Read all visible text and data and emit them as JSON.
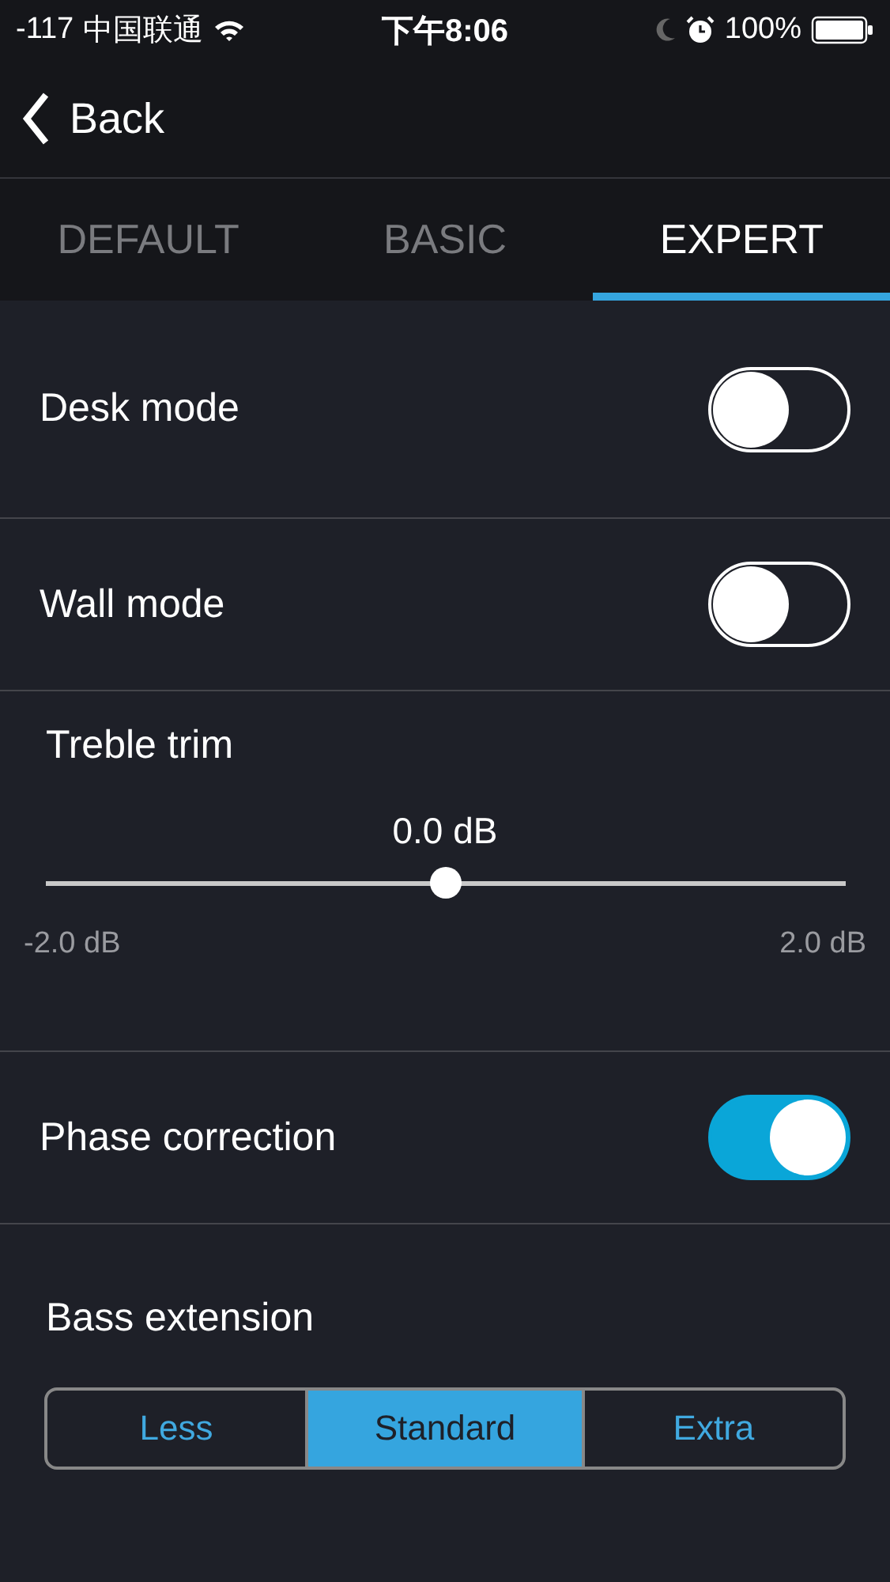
{
  "status_bar": {
    "signal": "-117",
    "carrier": "中国联通",
    "time": "下午8:06",
    "battery": "100%"
  },
  "nav": {
    "back": "Back"
  },
  "tabs": [
    {
      "label": "DEFAULT",
      "selected": false
    },
    {
      "label": "BASIC",
      "selected": false
    },
    {
      "label": "EXPERT",
      "selected": true
    }
  ],
  "settings": [
    {
      "kind": "toggle",
      "label": "Desk mode",
      "on": false
    },
    {
      "kind": "toggle",
      "label": "Wall mode",
      "on": false
    },
    {
      "kind": "slider",
      "label": "Treble trim",
      "reading": "0.0 dB",
      "level": 0.5,
      "min": "-2.0 dB",
      "max": "2.0 dB"
    },
    {
      "kind": "toggle",
      "label": "Phase correction",
      "on": true
    },
    {
      "kind": "segmented",
      "label": "Bass extension",
      "options": [
        {
          "label": "Less",
          "selected": false
        },
        {
          "label": "Standard",
          "selected": true
        },
        {
          "label": "Extra",
          "selected": false
        }
      ]
    }
  ]
}
